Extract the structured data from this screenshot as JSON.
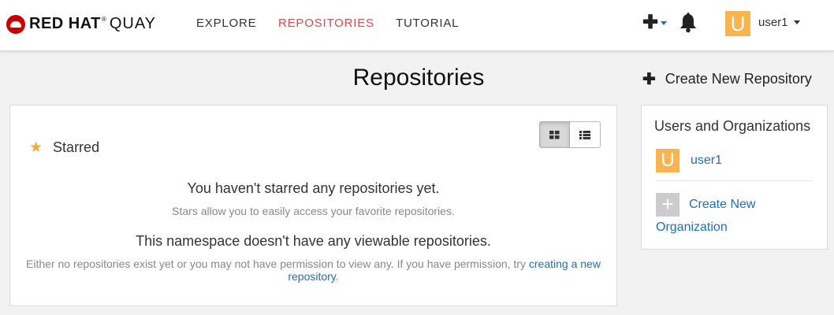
{
  "header": {
    "brand_main": "RED HAT",
    "brand_reg": "®",
    "brand_product": "QUAY",
    "nav": [
      {
        "label": "EXPLORE",
        "active": false
      },
      {
        "label": "REPOSITORIES",
        "active": true
      },
      {
        "label": "TUTORIAL",
        "active": false
      }
    ],
    "plus_glyph": "✚",
    "user": {
      "initial": "U",
      "name": "user1"
    }
  },
  "main": {
    "title": "Repositories",
    "starred_label": "Starred",
    "empty_starred_heading": "You haven't starred any repositories yet.",
    "empty_starred_sub": "Stars allow you to easily access your favorite repositories.",
    "empty_ns_heading": "This namespace doesn't have any viewable repositories.",
    "empty_ns_sub_prefix": "Either no repositories exist yet or you may not have permission to view any. If you have permission, try ",
    "empty_ns_link": "creating a new repository",
    "empty_ns_sub_suffix": "."
  },
  "sidebar": {
    "create_repo_label": "Create New Repository",
    "panel_title": "Users and Organizations",
    "user": {
      "initial": "U",
      "name": "user1"
    },
    "create_org_label": "Create New Organization",
    "plus_glyph": "+"
  },
  "colors": {
    "accent_red": "#e0474c",
    "link_blue": "#1d6fb8",
    "avatar_orange": "#f8b44f",
    "star_orange": "#f4a942"
  },
  "icons": [
    "red-hat-logo-icon",
    "plus-icon",
    "bell-icon",
    "caret-down-icon",
    "star-icon",
    "grid-view-icon",
    "list-view-icon"
  ]
}
